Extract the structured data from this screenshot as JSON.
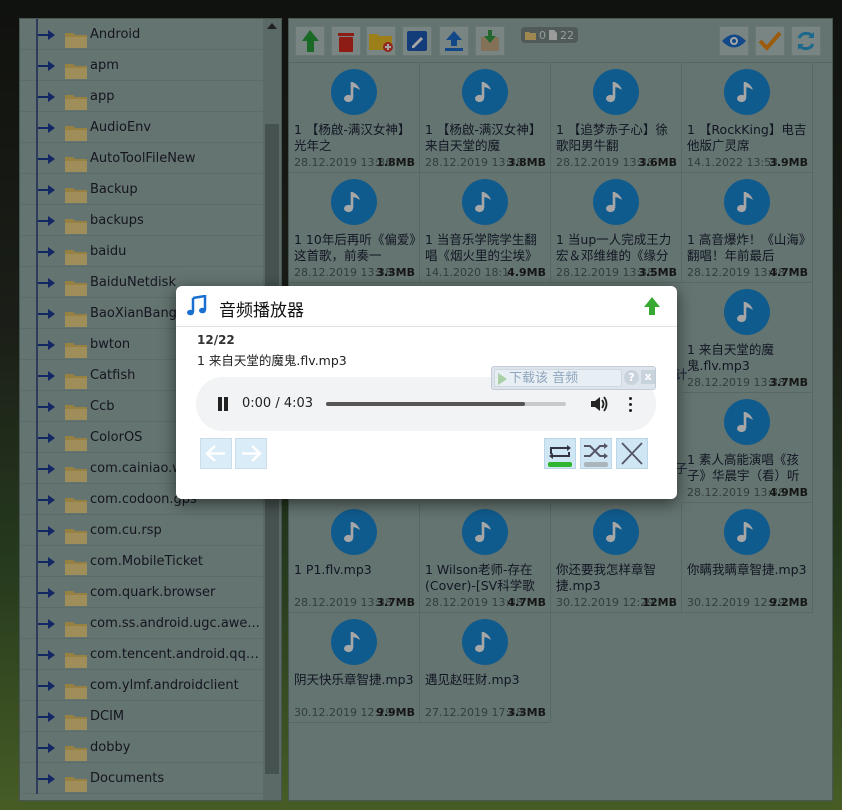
{
  "tree": {
    "folders": [
      "Android",
      "apm",
      "app",
      "AudioEnv",
      "AutoToolFileNew",
      "Backup",
      "backups",
      "baidu",
      "BaiduNetdisk",
      "BaoXianBang",
      "bwton",
      "Catfish",
      "Ccb",
      "ColorOS",
      "com.cainiao.w",
      "com.codoon.gps",
      "com.cu.rsp",
      "com.MobileTicket",
      "com.quark.browser",
      "com.ss.android.ugc.awe...",
      "com.tencent.android.qqd...",
      "com.ylmf.androidclient",
      "DCIM",
      "dobby",
      "Documents"
    ]
  },
  "toolbar": {
    "buttons": [
      "back-arrow-icon",
      "delete-icon",
      "new-folder-icon",
      "rename-icon",
      "upload-icon",
      "download-icon",
      "view-icon",
      "select-icon",
      "refresh-icon"
    ],
    "folder_count": "0",
    "file_count": "22"
  },
  "files": [
    {
      "title": "1 【杨啟-满汉女神】光年之",
      "date": "28.12.2019 13:36",
      "size": "1.8MB"
    },
    {
      "title": "1 【杨啟-满汉女神】来自天堂的魔",
      "date": "28.12.2019 13:38",
      "size": "3.8MB"
    },
    {
      "title": "1 【追梦赤子心】徐歌阳男牛翻",
      "date": "28.12.2019 13:38",
      "size": "3.6MB"
    },
    {
      "title": "1 【RockKing】电吉他版广灵席",
      "date": "14.1.2022 13:53",
      "size": "3.9MB"
    },
    {
      "title": "1 10年后再听《偏爱》这首歌，前奏一",
      "date": "28.12.2019 13:38",
      "size": "3.3MB"
    },
    {
      "title": "1 当音乐学院学生翻唱《烟火里的尘埃》",
      "date": "14.1.2020 18:1",
      "size": "4.9MB"
    },
    {
      "title": "1 当up一人完成王力宏＆邓维维的《缘分",
      "date": "28.12.2019 13:38",
      "size": "3.5MB"
    },
    {
      "title": "1 高音爆炸！《山海》翻唱！年前最后",
      "date": "28.12.2019 13:38",
      "size": "4.7MB"
    },
    {
      "title": "1 来自天堂的魔鬼.flv.mp3",
      "date": "28.12.2019 13:38",
      "size": "3.7MB"
    },
    {
      "title": "1 素人高能演唱《孩子》华晨宇（看）听",
      "date": "28.12.2019 13:38",
      "size": "4.9MB"
    },
    {
      "title": "1 P1.flv.mp3",
      "date": "28.12.2019 13:38",
      "size": "3.7MB"
    },
    {
      "title": "1 Wilson老师-存在(Cover)-[SV科学歌",
      "date": "28.12.2019 13:38",
      "size": "4.7MB"
    },
    {
      "title": "你还要我怎样章智捷.mp3",
      "date": "30.12.2019 12:29",
      "size": "12MB"
    },
    {
      "title": "你瞒我瞒章智捷.mp3",
      "date": "30.12.2019 12:29",
      "size": "9.2MB"
    },
    {
      "title": "阴天快乐章智捷.mp3",
      "date": "30.12.2019 12:29",
      "size": "9.9MB"
    },
    {
      "title": "遇见赵旺财.mp3",
      "date": "27.12.2019 17:48",
      "size": "3.3MB"
    }
  ],
  "partial_text": {
    "t1": "计",
    "t2": "子"
  },
  "player": {
    "title": "音频播放器",
    "index": "12/22",
    "file": "1 来自天堂的魔鬼.flv.mp3",
    "time": "0:00 / 4:03",
    "progress": 0.83,
    "download_label": "下载该 音频",
    "help_label": "?",
    "close_label": "x"
  },
  "colors": {
    "accent": "#1a8ddb",
    "panel": "#9ab3ad",
    "dialog": "#ffffff"
  }
}
